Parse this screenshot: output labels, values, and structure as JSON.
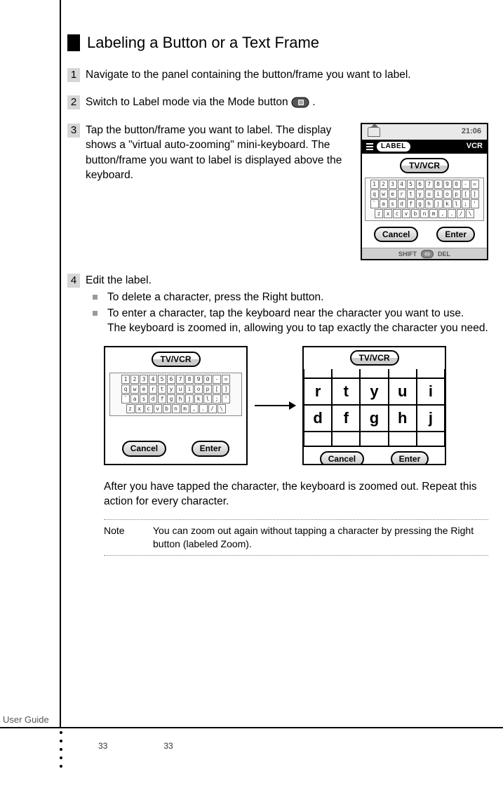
{
  "heading": "Labeling a Button or a Text Frame",
  "steps": {
    "s1": {
      "num": "1",
      "text": "Navigate to the panel containing the button/frame you want to label."
    },
    "s2": {
      "num": "2",
      "text_before": "Switch to Label mode via the Mode button ",
      "text_after": "."
    },
    "s3": {
      "num": "3",
      "text": "Tap the button/frame you want to label. The display shows a \"virtual auto-zooming\" mini-keyboard. The button/frame you want to label is displayed above the keyboard."
    },
    "s4": {
      "num": "4",
      "text": "Edit the label.",
      "bullets": [
        "To delete a character, press the Right button.",
        "To enter a character, tap the keyboard near the character you want to use.\nThe keyboard is zoomed in, allowing you to tap exactly the character you need."
      ]
    }
  },
  "after_text": "After you have tapped the character, the keyboard is zoomed out. Repeat this action for every character.",
  "note": {
    "label": "Note",
    "body": "You can zoom out again without tapping a character by pressing the Right button (labeled Zoom)."
  },
  "device": {
    "time": "21:06",
    "mode_label": "LABEL",
    "device_label": "VCR",
    "target_label": "TV/VCR",
    "cancel": "Cancel",
    "enter": "Enter",
    "shift": "SHIFT",
    "del": "DEL",
    "kbd_rows": {
      "r1": [
        "1",
        "2",
        "3",
        "4",
        "5",
        "6",
        "7",
        "8",
        "9",
        "0",
        "-",
        "="
      ],
      "r2": [
        "q",
        "w",
        "e",
        "r",
        "t",
        "y",
        "u",
        "i",
        "o",
        "p",
        "[",
        "]"
      ],
      "r3": [
        "a",
        "s",
        "d",
        "f",
        "g",
        "h",
        "j",
        "k",
        "l",
        ";",
        "'"
      ],
      "r4": [
        "z",
        "x",
        "c",
        "v",
        "b",
        "n",
        "m",
        ",",
        ".",
        "/",
        "\\"
      ]
    }
  },
  "zoom": {
    "row_top": [
      "r",
      "t",
      "y",
      "u",
      "i"
    ],
    "row_mid": [
      "d",
      "f",
      "g",
      "h",
      "j"
    ]
  },
  "footer": {
    "guide": "User Guide",
    "page_a": "33",
    "page_b": "33"
  }
}
